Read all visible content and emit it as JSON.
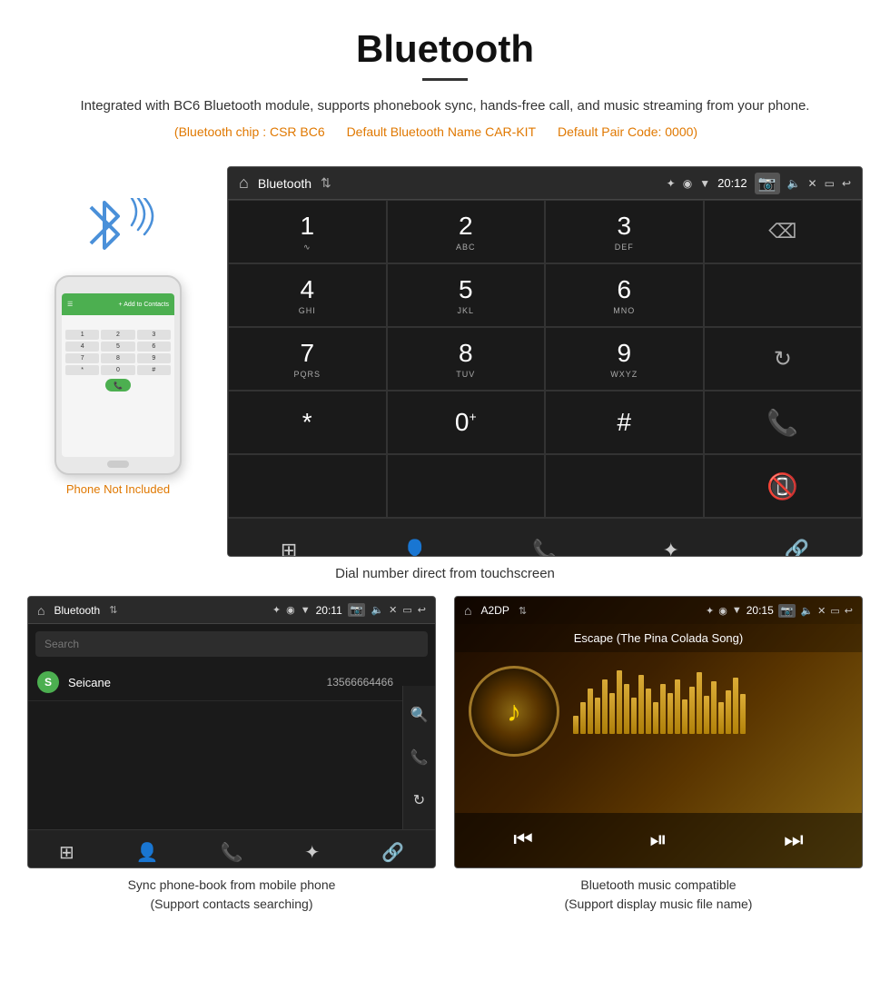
{
  "header": {
    "title": "Bluetooth",
    "divider": true,
    "description": "Integrated with BC6 Bluetooth module, supports phonebook sync, hands-free call, and music streaming from your phone.",
    "specs": {
      "chip": "(Bluetooth chip : CSR BC6",
      "name": "Default Bluetooth Name CAR-KIT",
      "code": "Default Pair Code: 0000)"
    }
  },
  "android_dialpad": {
    "status_bar": {
      "app_name": "Bluetooth",
      "time": "20:12"
    },
    "keys": [
      {
        "main": "1",
        "sub": ""
      },
      {
        "main": "2",
        "sub": "ABC"
      },
      {
        "main": "3",
        "sub": "DEF"
      },
      {
        "main": "",
        "sub": ""
      },
      {
        "main": "4",
        "sub": "GHI"
      },
      {
        "main": "5",
        "sub": "JKL"
      },
      {
        "main": "6",
        "sub": "MNO"
      },
      {
        "main": "",
        "sub": ""
      },
      {
        "main": "7",
        "sub": "PQRS"
      },
      {
        "main": "8",
        "sub": "TUV"
      },
      {
        "main": "9",
        "sub": "WXYZ"
      },
      {
        "main": "",
        "sub": ""
      },
      {
        "main": "*",
        "sub": ""
      },
      {
        "main": "0",
        "sub": "+"
      },
      {
        "main": "#",
        "sub": ""
      },
      {
        "main": "",
        "sub": ""
      }
    ],
    "caption": "Dial number direct from touchscreen"
  },
  "phone_section": {
    "not_included_text": "Phone Not Included"
  },
  "phonebook": {
    "status_bar": {
      "app_name": "Bluetooth",
      "time": "20:11"
    },
    "search_placeholder": "Search",
    "contacts": [
      {
        "letter": "S",
        "name": "Seicane",
        "number": "13566664466"
      }
    ],
    "caption_line1": "Sync phone-book from mobile phone",
    "caption_line2": "(Support contacts searching)"
  },
  "music": {
    "status_bar": {
      "app_name": "A2DP",
      "time": "20:15"
    },
    "song_name": "Escape (The Pina Colada Song)",
    "caption_line1": "Bluetooth music compatible",
    "caption_line2": "(Support display music file name)"
  },
  "visualizer_heights": [
    20,
    35,
    50,
    40,
    60,
    45,
    70,
    55,
    40,
    65,
    50,
    35,
    55,
    45,
    60,
    38,
    52,
    68,
    42,
    58,
    35,
    48,
    62,
    44
  ]
}
